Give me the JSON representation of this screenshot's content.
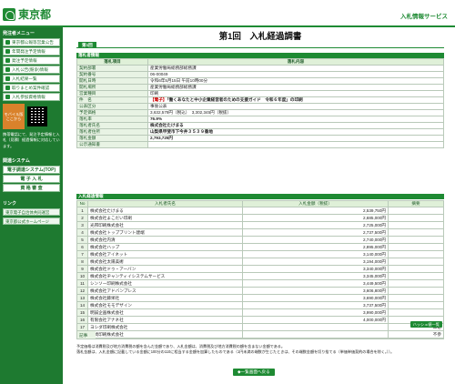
{
  "header": {
    "logo_text": "東京都",
    "service_title": "入札情報サービス"
  },
  "sidebar": {
    "menu_title": "発注者メニュー",
    "menu_items": [
      "東京都公報等営業公告",
      "年間発注予定情報",
      "発注予定情報",
      "入札公告(競争)情報",
      "入札結果一覧",
      "取りまとめ案件確認",
      "入札参加資格情報"
    ],
    "mobile_button": [
      "モバイル版",
      "ここから"
    ],
    "mobile_note": "携帯電話にて、発注予定情報と入札（見積）経過情報に対応しています。",
    "sub_title": "関連システム",
    "systems": [
      "電子調達システム(TOP)",
      "電 子 入 札",
      "資 格 審 査"
    ],
    "links_title": "リンク",
    "links": [
      "東京電子自治体共同運営",
      "東京都公式ホームページ"
    ]
  },
  "page": {
    "title": "第1回　入札経過調書",
    "tab": "第1回"
  },
  "info": {
    "section": "落札者情報",
    "col_item": "落札項目",
    "col_content": "落札内容",
    "rows": [
      {
        "k": "契約部署",
        "v": "産業労働局総務部総務課"
      },
      {
        "k": "契約番号",
        "v": "06-00049"
      },
      {
        "k": "開札日時",
        "v": "令和6年5月15日 午前10時00分"
      },
      {
        "k": "開札場所",
        "v": "産業労働局総務部総務課"
      },
      {
        "k": "営業種目",
        "v": "印刷"
      },
      {
        "k": "件　名",
        "tag": "【電子】",
        "v": "「働くあなたと中小企業経営者のための支援ガイド　令和６年度」の印刷"
      },
      {
        "k": "公表区分",
        "v": "事後公表"
      },
      {
        "k": "予定価格",
        "v": "3,632,579円（税込）　3,302,345円（税抜）"
      },
      {
        "k": "落札率",
        "v": "76.9%"
      },
      {
        "k": "落札者氏名",
        "v": "株式会社たけまる"
      },
      {
        "k": "落札者住所",
        "v": "山梨県甲斐市下今井３５３９番地"
      },
      {
        "k": "落札金額",
        "v": "2,793,725円"
      },
      {
        "k": "公示通知書",
        "v": ""
      }
    ]
  },
  "bids": {
    "section": "入札経過情報",
    "col_no": "No",
    "col_name": "入札者氏名",
    "col_amount": "入札金額（税抜）",
    "col_note": "摘要",
    "rows": [
      {
        "no": "1",
        "name": "株式会社たけまる",
        "amount": "2,539,750円",
        "note": ""
      },
      {
        "no": "2",
        "name": "株式会社よこだい印刷",
        "amount": "2,685,000円",
        "note": ""
      },
      {
        "no": "3",
        "name": "光邦印刷株式会社",
        "amount": "2,725,000円",
        "note": ""
      },
      {
        "no": "4",
        "name": "株式会社トップブリント建端",
        "amount": "2,737,500円",
        "note": ""
      },
      {
        "no": "5",
        "name": "株式会社内清",
        "amount": "2,740,000円",
        "note": ""
      },
      {
        "no": "6",
        "name": "株式会社ハップ",
        "amount": "2,895,000円",
        "note": ""
      },
      {
        "no": "7",
        "name": "株式会社アイネット",
        "amount": "3,140,000円",
        "note": ""
      },
      {
        "no": "8",
        "name": "株式会社太陽美術",
        "amount": "3,194,000円",
        "note": ""
      },
      {
        "no": "9",
        "name": "株式会社ドゥ・アーバン",
        "amount": "3,340,000円",
        "note": ""
      },
      {
        "no": "10",
        "name": "株式会社ヂャンティイシステムサービス",
        "amount": "3,345,000円",
        "note": ""
      },
      {
        "no": "11",
        "name": "シンソー印刷株式会社",
        "amount": "3,449,500円",
        "note": ""
      },
      {
        "no": "12",
        "name": "株式会社アドバンプレス",
        "amount": "3,606,800円",
        "note": ""
      },
      {
        "no": "13",
        "name": "株式会社藤栄社",
        "amount": "3,690,000円",
        "note": ""
      },
      {
        "no": "14",
        "name": "株式会社モモデザイン",
        "amount": "3,737,500円",
        "note": ""
      },
      {
        "no": "15",
        "name": "明誠企画株式会社",
        "amount": "3,990,000円",
        "note": ""
      },
      {
        "no": "16",
        "name": "有限会社アナネ社",
        "amount": "4,000,000円",
        "note": ""
      },
      {
        "no": "17",
        "name": "ヨシダ印刷株式会社",
        "amount": "",
        "note": "辞退"
      },
      {
        "no": "18",
        "name": "宮崎印刷株式会社",
        "amount": "",
        "note": "不参"
      }
    ]
  },
  "hash_button": "ハッシュ値一覧",
  "remarks_label": "記事",
  "notes": [
    "予定価格は消費税及び地方消費税の額を含んだ金額であり、入札金額は、消費税及び地方消費税の額を含まない金額である。",
    "落札金額は、入札金額に記載している金額に100分の110に相当する金額を加算したものである（1円未満の端数が生じたときは、その端数金額を切り捨てる（単価単価契約の場合を除く。））。"
  ],
  "back_button": "◆一覧画面へ戻る"
}
